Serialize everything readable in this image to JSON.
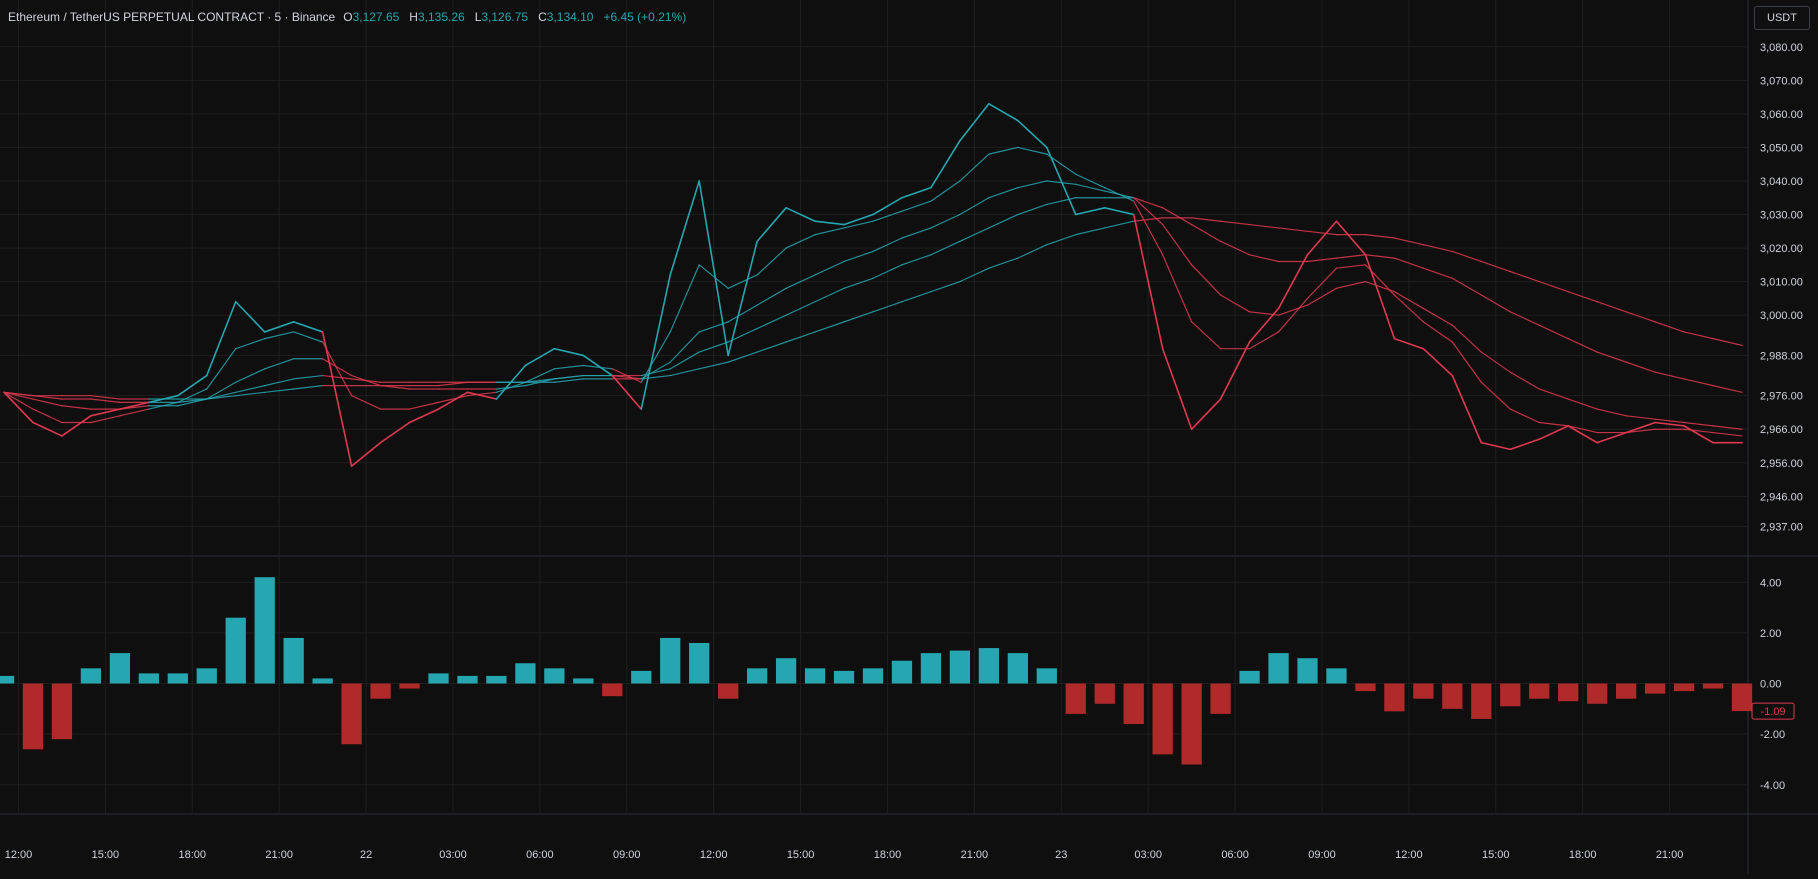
{
  "header": {
    "symbol": "Ethereum / TetherUS PERPETUAL CONTRACT · 5 · Binance",
    "open_key": "O",
    "open": "3,127.65",
    "high_key": "H",
    "high": "3,135.26",
    "low_key": "L",
    "low": "3,126.75",
    "close_key": "C",
    "close": "3,134.10",
    "change": "+6.45 (+0.21%)"
  },
  "currency_button": "USDT",
  "colors": {
    "background": "#0f0f0f",
    "up": "#26a6b0",
    "down": "#e0394f",
    "grid": "#1e1e1e",
    "axis_text": "#d1d4dc",
    "hist_down": "#b02a2a"
  },
  "chart_data": [
    {
      "type": "line",
      "panel": "price",
      "ylim": [
        2930,
        3085
      ],
      "y_ticks": [
        "3,080.00",
        "3,070.00",
        "3,060.00",
        "3,050.00",
        "3,040.00",
        "3,030.00",
        "3,020.00",
        "3,010.00",
        "3,000.00",
        "2,988.00",
        "2,976.00",
        "2,966.00",
        "2,956.00",
        "2,946.00",
        "2,937.00"
      ],
      "x_ticks": [
        "12:00",
        "15:00",
        "18:00",
        "21:00",
        "22",
        "03:00",
        "06:00",
        "09:00",
        "12:00",
        "15:00",
        "18:00",
        "21:00",
        "23",
        "03:00",
        "06:00",
        "09:00",
        "12:00",
        "15:00",
        "18:00",
        "21:00"
      ],
      "x_tick_pos": [
        0.5,
        3.5,
        6.5,
        9.5,
        12.5,
        15.5,
        18.5,
        21.5,
        24.5,
        27.5,
        30.5,
        33.5,
        36.5,
        39.5,
        42.5,
        45.5,
        48.5,
        51.5,
        54.5,
        57.5
      ],
      "x": [
        0,
        1,
        2,
        3,
        4,
        5,
        6,
        7,
        8,
        9,
        10,
        11,
        12,
        13,
        14,
        15,
        16,
        17,
        18,
        19,
        20,
        21,
        22,
        23,
        24,
        25,
        26,
        27,
        28,
        29,
        30,
        31,
        32,
        33,
        34,
        35,
        36,
        37,
        38,
        39,
        40,
        41,
        42,
        43,
        44,
        45,
        46,
        47,
        48,
        49,
        50,
        51,
        52,
        53,
        54,
        55,
        56,
        57,
        58,
        59,
        60
      ],
      "series": [
        {
          "values": [
            2977,
            2968,
            2964,
            2970,
            2972,
            2974,
            2976,
            2982,
            3004,
            2995,
            2998,
            2995,
            2955,
            2962,
            2968,
            2972,
            2977,
            2975,
            2985,
            2990,
            2988,
            2982,
            2972,
            3012,
            3040,
            2988,
            3022,
            3032,
            3028,
            3027,
            3030,
            3035,
            3038,
            3052,
            3063,
            3058,
            3050,
            3030,
            3032,
            3030,
            2990,
            2966,
            2975,
            2992,
            3002,
            3018,
            3028,
            3018,
            2993,
            2990,
            2982,
            2962,
            2960,
            2963,
            2967,
            2962,
            2965,
            2968,
            2967,
            2962,
            2962
          ]
        },
        {
          "values": [
            2977,
            2972,
            2968,
            2968,
            2970,
            2972,
            2974,
            2978,
            2990,
            2993,
            2995,
            2992,
            2976,
            2972,
            2972,
            2974,
            2976,
            2977,
            2980,
            2984,
            2985,
            2984,
            2980,
            2995,
            3015,
            3008,
            3012,
            3020,
            3024,
            3026,
            3028,
            3031,
            3034,
            3040,
            3048,
            3050,
            3048,
            3042,
            3038,
            3034,
            3018,
            2998,
            2990,
            2990,
            2995,
            3005,
            3014,
            3015,
            3006,
            2998,
            2992,
            2980,
            2972,
            2968,
            2967,
            2965,
            2965,
            2966,
            2966,
            2965,
            2964
          ]
        },
        {
          "values": [
            2977,
            2975,
            2973,
            2972,
            2972,
            2973,
            2973,
            2975,
            2980,
            2984,
            2987,
            2987,
            2982,
            2979,
            2978,
            2978,
            2978,
            2978,
            2979,
            2981,
            2982,
            2982,
            2981,
            2986,
            2995,
            2998,
            3003,
            3008,
            3012,
            3016,
            3019,
            3023,
            3026,
            3030,
            3035,
            3038,
            3040,
            3039,
            3037,
            3035,
            3027,
            3015,
            3006,
            3001,
            3000,
            3003,
            3008,
            3010,
            3007,
            3002,
            2997,
            2989,
            2983,
            2978,
            2975,
            2972,
            2970,
            2969,
            2968,
            2967,
            2966
          ]
        },
        {
          "values": [
            2977,
            2976,
            2975,
            2975,
            2974,
            2974,
            2974,
            2975,
            2977,
            2979,
            2981,
            2982,
            2981,
            2980,
            2980,
            2980,
            2980,
            2980,
            2980,
            2981,
            2982,
            2982,
            2982,
            2984,
            2989,
            2992,
            2996,
            3000,
            3004,
            3008,
            3011,
            3015,
            3018,
            3022,
            3026,
            3030,
            3033,
            3035,
            3035,
            3035,
            3032,
            3027,
            3022,
            3018,
            3016,
            3016,
            3017,
            3018,
            3017,
            3014,
            3011,
            3006,
            3001,
            2997,
            2993,
            2989,
            2986,
            2983,
            2981,
            2979,
            2977
          ]
        },
        {
          "values": [
            2977,
            2976,
            2976,
            2976,
            2975,
            2975,
            2975,
            2975,
            2976,
            2977,
            2978,
            2979,
            2979,
            2979,
            2979,
            2979,
            2980,
            2980,
            2980,
            2980,
            2981,
            2981,
            2981,
            2982,
            2984,
            2986,
            2989,
            2992,
            2995,
            2998,
            3001,
            3004,
            3007,
            3010,
            3014,
            3017,
            3021,
            3024,
            3026,
            3028,
            3029,
            3029,
            3028,
            3027,
            3026,
            3025,
            3024,
            3024,
            3023,
            3021,
            3019,
            3016,
            3013,
            3010,
            3007,
            3004,
            3001,
            2998,
            2995,
            2993,
            2991
          ]
        }
      ]
    },
    {
      "type": "bar",
      "panel": "oscillator",
      "ylim": [
        -4.8,
        4.8
      ],
      "y_ticks": [
        "4.00",
        "2.00",
        "0.00",
        "-2.00",
        "-4.00"
      ],
      "last_value_label": "-1.09",
      "x": [
        0,
        1,
        2,
        3,
        4,
        5,
        6,
        7,
        8,
        9,
        10,
        11,
        12,
        13,
        14,
        15,
        16,
        17,
        18,
        19,
        20,
        21,
        22,
        23,
        24,
        25,
        26,
        27,
        28,
        29,
        30,
        31,
        32,
        33,
        34,
        35,
        36,
        37,
        38,
        39,
        40,
        41,
        42,
        43,
        44,
        45,
        46,
        47,
        48,
        49,
        50,
        51,
        52,
        53,
        54,
        55,
        56,
        57,
        58,
        59,
        60
      ],
      "values": [
        0.3,
        -2.6,
        -2.2,
        0.6,
        1.2,
        0.4,
        0.4,
        0.6,
        2.6,
        4.2,
        1.8,
        0.2,
        -2.4,
        -0.6,
        -0.2,
        0.4,
        0.3,
        0.3,
        0.8,
        0.6,
        0.2,
        -0.5,
        0.5,
        1.8,
        1.6,
        -0.6,
        0.6,
        1.0,
        0.6,
        0.5,
        0.6,
        0.9,
        1.2,
        1.3,
        1.4,
        1.2,
        0.6,
        -1.2,
        -0.8,
        -1.6,
        -2.8,
        -3.2,
        -1.2,
        0.5,
        1.2,
        1.0,
        0.6,
        -0.3,
        -1.1,
        -0.6,
        -1.0,
        -1.4,
        -0.9,
        -0.6,
        -0.7,
        -0.8,
        -0.6,
        -0.4,
        -0.3,
        -0.2,
        -1.09
      ]
    }
  ]
}
